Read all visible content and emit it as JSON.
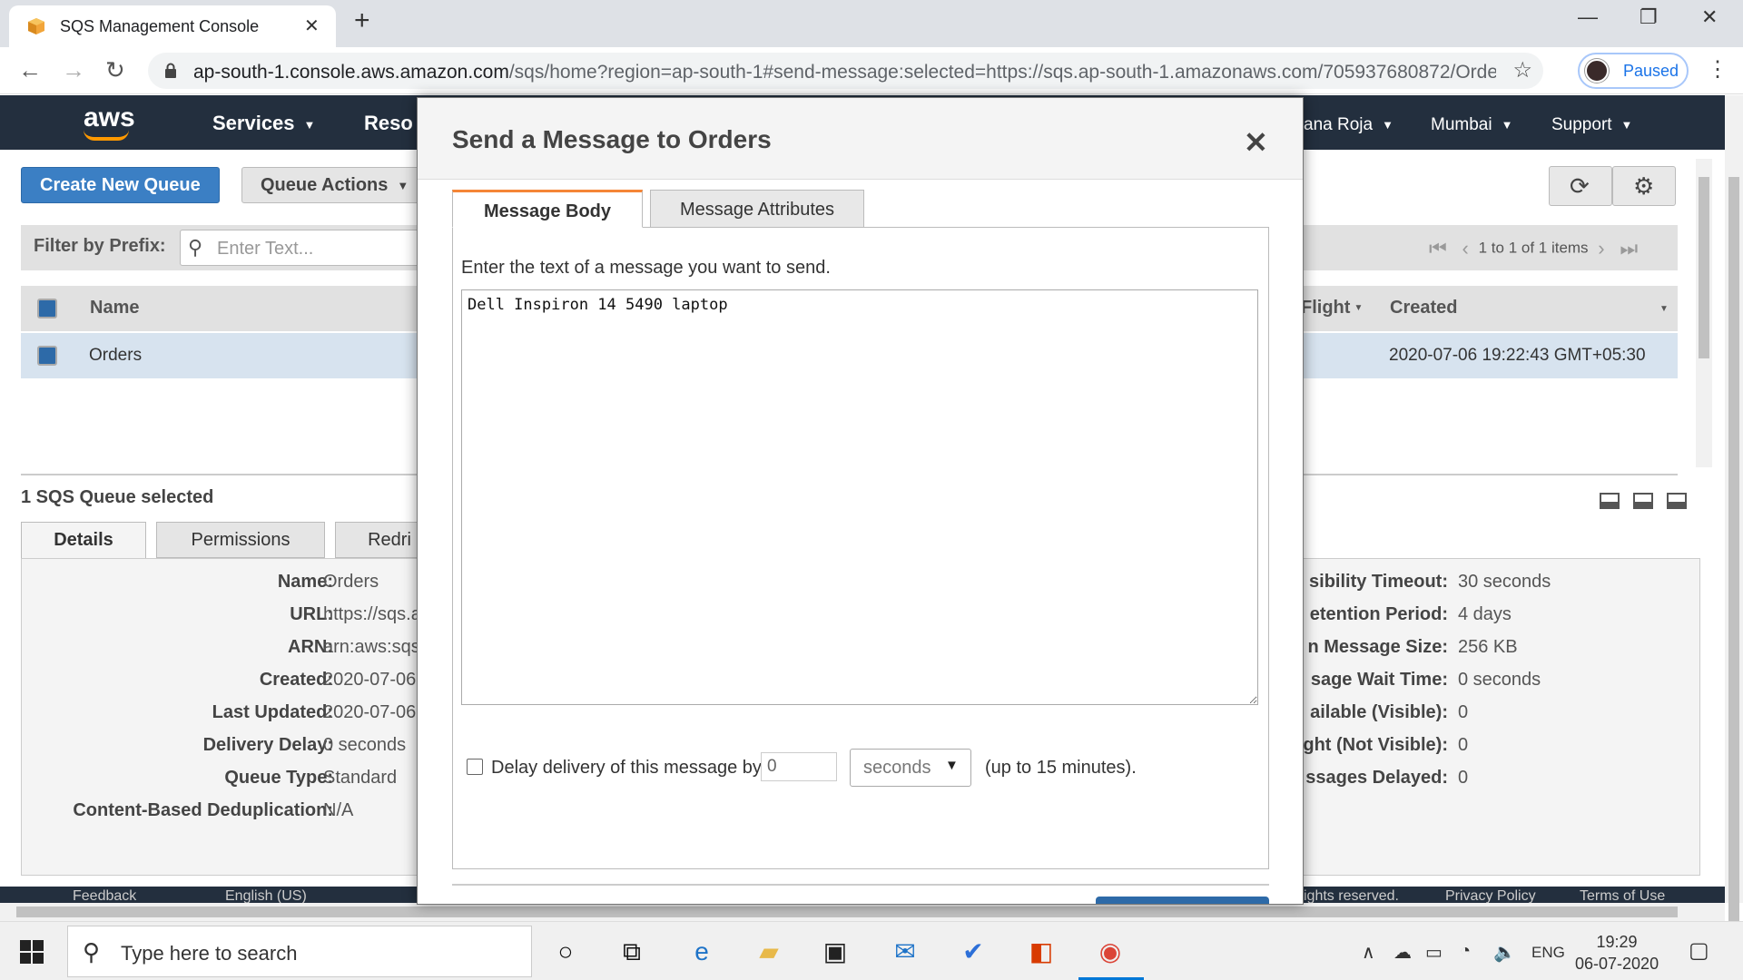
{
  "browser": {
    "tab_title": "SQS Management Console",
    "url_host": "ap-south-1.console.aws.amazon.com",
    "url_rest": "/sqs/home?region=ap-south-1#send-message:selected=https://sqs.ap-south-1.amazonaws.com/705937680872/Order...",
    "profile_label": "Paused"
  },
  "aws_nav": {
    "logo": "aws",
    "services": "Services",
    "resource_groups": "Reso",
    "user": "ana Roja",
    "region": "Mumbai",
    "support": "Support"
  },
  "toolbar": {
    "create_queue": "Create New Queue",
    "queue_actions": "Queue Actions"
  },
  "filter": {
    "label": "Filter by Prefix:",
    "placeholder": "Enter Text...",
    "pager_text": "1 to 1 of 1 items"
  },
  "table": {
    "col_name": "Name",
    "col_inflight": "Flight",
    "col_created": "Created",
    "rows": [
      {
        "name": "Orders",
        "created": "2020-07-06 19:22:43 GMT+05:30"
      }
    ]
  },
  "selection": {
    "title": "1 SQS Queue selected",
    "tabs": [
      "Details",
      "Permissions",
      "Redri"
    ]
  },
  "details_left": [
    {
      "label": "Name:",
      "value": "Orders"
    },
    {
      "label": "URL:",
      "value": "https://sqs.a"
    },
    {
      "label": "ARN:",
      "value": "arn:aws:sqs"
    },
    {
      "label": "Created:",
      "value": "2020-07-06"
    },
    {
      "label": "Last Updated:",
      "value": "2020-07-06"
    },
    {
      "label": "Delivery Delay:",
      "value": "0 seconds"
    },
    {
      "label": "Queue Type:",
      "value": "Standard"
    },
    {
      "label": "Content-Based Deduplication:",
      "value": "N/A"
    }
  ],
  "details_right": [
    {
      "label": "sibility Timeout:",
      "value": "30 seconds"
    },
    {
      "label": "etention Period:",
      "value": "4 days"
    },
    {
      "label": "n Message Size:",
      "value": "256 KB"
    },
    {
      "label": "sage Wait Time:",
      "value": "0 seconds"
    },
    {
      "label": "ailable (Visible):",
      "value": "0"
    },
    {
      "label": "ght (Not Visible):",
      "value": "0"
    },
    {
      "label": "ssages Delayed:",
      "value": "0"
    }
  ],
  "footer": {
    "feedback": "Feedback",
    "language": "English (US)",
    "rights": "ights reserved.",
    "privacy": "Privacy Policy",
    "terms": "Terms of Use"
  },
  "modal": {
    "title": "Send a Message to Orders",
    "tab_body": "Message Body",
    "tab_attributes": "Message Attributes",
    "prompt": "Enter the text of a message you want to send.",
    "message_text": "Dell Inspiron 14 5490 laptop",
    "delay_label": "Delay delivery of this message by",
    "delay_value": "0",
    "delay_unit": "seconds",
    "delay_hint": "(up to 15 minutes)."
  },
  "taskbar": {
    "search_placeholder": "Type here to search",
    "lang": "ENG",
    "time": "19:29",
    "date": "06-07-2020"
  },
  "colors": {
    "aws_nav": "#232f3e",
    "aws_orange": "#ff9900",
    "primary_button": "#3b7fc4",
    "selected_row": "#d7e3ef",
    "active_tab_accent": "#f58536"
  }
}
